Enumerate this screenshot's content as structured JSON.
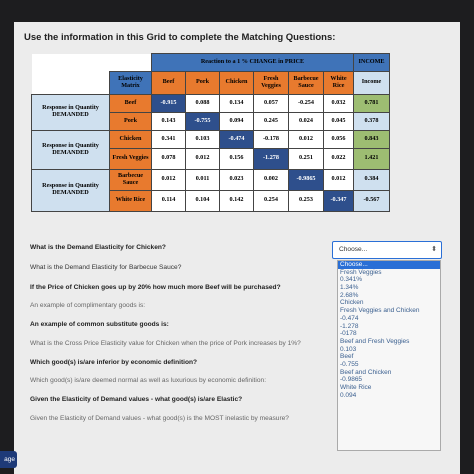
{
  "heading": "Use the information in this Grid to complete the Matching Questions:",
  "grid": {
    "reaction_header": "Reaction to a 1 % CHANGE in PRICE",
    "income_header": "INCOME",
    "matrix_label": "Elasticity Matrix",
    "columns": [
      "Beef",
      "Pork",
      "Chicken",
      "Fresh Veggies",
      "Barbecue Sauce",
      "White Rice",
      "Income"
    ],
    "group_labels": [
      "Response in Quantity DEMANDED",
      "Response in Quantity DEMANDED",
      "Response in Quantity DEMANDED"
    ],
    "rows": [
      {
        "label": "Beef",
        "values": [
          "-0.915",
          "0.088",
          "0.134",
          "0.057",
          "-0.254",
          "0.032",
          "0.781"
        ]
      },
      {
        "label": "Pork",
        "values": [
          "0.143",
          "-0.755",
          "0.094",
          "0.245",
          "0.024",
          "0.045",
          "0.378"
        ]
      },
      {
        "label": "Chicken",
        "values": [
          "0.341",
          "0.103",
          "-0.474",
          "-0.178",
          "0.012",
          "0.056",
          "0.843"
        ]
      },
      {
        "label": "Fresh Veggies",
        "values": [
          "0.078",
          "0.012",
          "0.156",
          "-1.278",
          "0.251",
          "0.022",
          "1.421"
        ]
      },
      {
        "label": "Barbecue Sauce",
        "values": [
          "0.012",
          "0.011",
          "0.023",
          "0.002",
          "-0.9865",
          "0.012",
          "0.384"
        ]
      },
      {
        "label": "White Rice",
        "values": [
          "0.114",
          "0.104",
          "0.142",
          "0.254",
          "0.253",
          "-0.347",
          "-0.567"
        ]
      }
    ]
  },
  "questions": [
    "What is the Demand Elasticity for Chicken?",
    "What is the Demand Elasticity for Barbecue Sauce?",
    "If the Price of Chicken goes up by 20% how much more Beef will be purchased?",
    "An example of complimentary goods is:",
    "An example of common substitute goods is:",
    "What is the Cross Price Elasticity value for Chicken when the price of Pork increases by 1%?",
    "Which good(s) is/are inferior by economic definition?",
    "Which good(s) is/are deemed normal as well as luxurious by economic definition:",
    "Given the Elasticity of Demand values - what good(s) is/are Elastic?",
    "Given the Elasticity of Demand values - what good(s) is the MOST inelastic by measure?"
  ],
  "select": {
    "value": "Choose...",
    "arrow": "⬍"
  },
  "options": [
    "Choose...",
    "Fresh Veggies",
    "0.341%",
    "1.34%",
    "2.68%",
    "Chicken",
    "Fresh Veggies and Chicken",
    "-0.474",
    "-1.278",
    "-0178",
    "Beef and Fresh Veggies",
    "0.103",
    "Beef",
    "-0.755",
    "Beef and Chicken",
    "-0.9865",
    "White Rice",
    "0.094"
  ],
  "page_button": "age"
}
